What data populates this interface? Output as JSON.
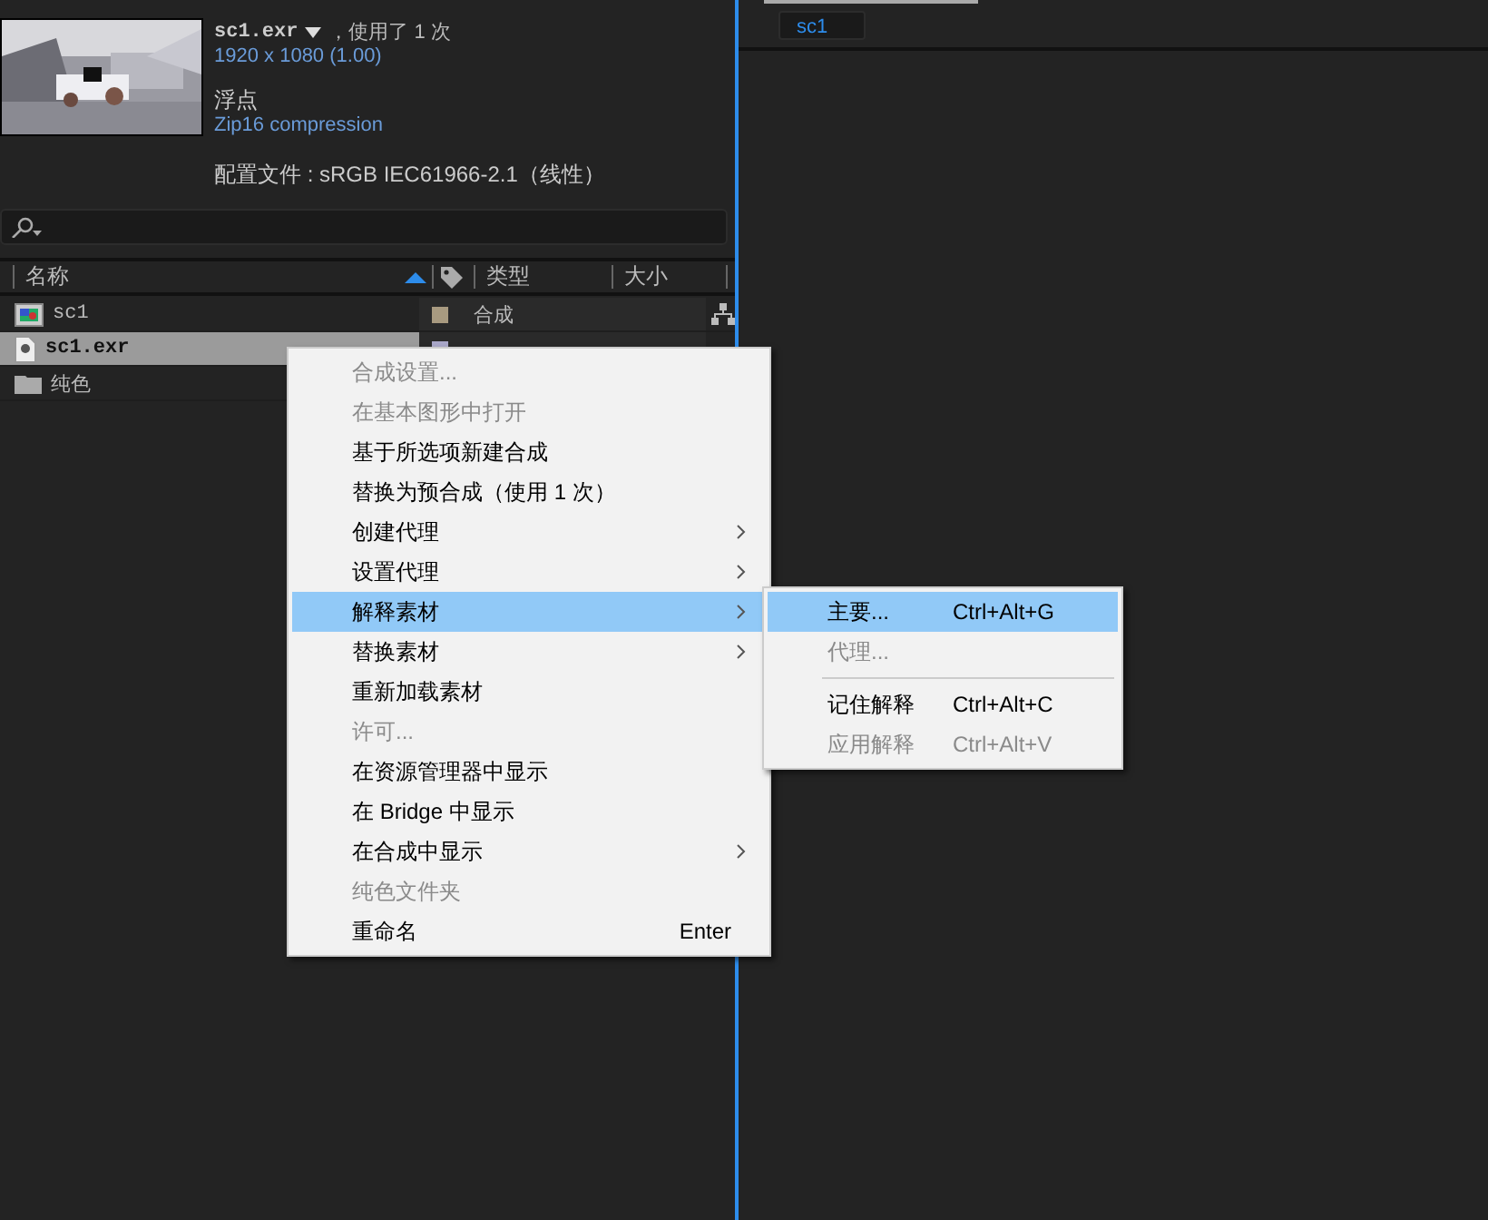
{
  "footage": {
    "kind": "picture",
    "name": "sc1.exr",
    "usage": "，使用了 1 次",
    "resolution": "1920 x 1080 (1.00)",
    "depth": "浮点",
    "compression": "Zip16 compression",
    "profile": "配置文件 : sRGB IEC61966-2.1（线性）"
  },
  "columns": [
    "名称",
    "类型",
    "大小"
  ],
  "rows": [
    {
      "kind": "comp",
      "name": "sc1",
      "type": "合成",
      "color": "#a89a80",
      "selected": false
    },
    {
      "kind": "footage",
      "name": "sc1.exr",
      "color": "#a9a7c8",
      "selected": true
    },
    {
      "kind": "folder",
      "name": "纯色",
      "selected": false
    }
  ],
  "viewer_tab": {
    "label": "sc1"
  },
  "context_menu": [
    {
      "label": "合成设置...",
      "disabled": true
    },
    {
      "label": "在基本图形中打开",
      "disabled": true
    },
    {
      "label": "基于所选项新建合成",
      "disabled": false
    },
    {
      "label": "替换为预合成（使用 1 次）",
      "disabled": false
    },
    {
      "label": "创建代理",
      "disabled": false,
      "submenu": true
    },
    {
      "label": "设置代理",
      "disabled": false,
      "submenu": true
    },
    {
      "label": "解释素材",
      "disabled": false,
      "submenu": true,
      "selected": true
    },
    {
      "label": "替换素材",
      "disabled": false,
      "submenu": true
    },
    {
      "label": "重新加载素材",
      "disabled": false
    },
    {
      "label": "许可...",
      "disabled": true
    },
    {
      "label": "在资源管理器中显示",
      "disabled": false
    },
    {
      "label": "在 Bridge 中显示",
      "disabled": false
    },
    {
      "label": "在合成中显示",
      "disabled": false,
      "submenu": true
    },
    {
      "label": "纯色文件夹",
      "disabled": true
    },
    {
      "label": "重命名",
      "disabled": false,
      "shortcut": "Enter"
    }
  ],
  "submenu": [
    {
      "label": "主要...",
      "shortcut": "Ctrl+Alt+G",
      "disabled": false,
      "selected": true
    },
    {
      "label": "代理...",
      "disabled": true,
      "selected": false
    },
    {
      "kind": "separator"
    },
    {
      "label": "记住解释",
      "shortcut": "Ctrl+Alt+C",
      "disabled": false,
      "selected": false
    },
    {
      "label": "应用解释",
      "shortcut": "Ctrl+Alt+V",
      "disabled": true,
      "selected": false
    }
  ]
}
